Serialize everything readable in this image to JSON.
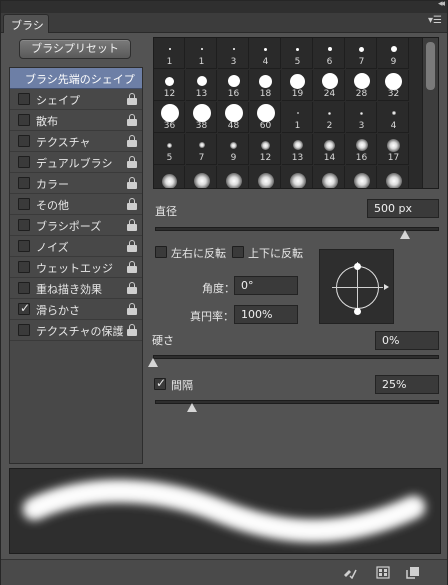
{
  "panel": {
    "tab_label": "ブラシ",
    "collapse_glyph": "◂◂",
    "menu_glyph": "▾☰"
  },
  "preset_button": {
    "label": "ブラシプリセット"
  },
  "left_list": {
    "selected": "ブラシ先端のシェイプ",
    "items": [
      {
        "label": "シェイプ",
        "checked": false
      },
      {
        "label": "散布",
        "checked": false
      },
      {
        "label": "テクスチャ",
        "checked": false
      },
      {
        "label": "デュアルブラシ",
        "checked": false
      },
      {
        "label": "カラー",
        "checked": false
      },
      {
        "label": "その他",
        "checked": false
      },
      {
        "label": "ブラシポーズ",
        "checked": false
      },
      {
        "label": "ノイズ",
        "checked": false
      },
      {
        "label": "ウェットエッジ",
        "checked": false
      },
      {
        "label": "重ね描き効果",
        "checked": false
      },
      {
        "label": "滑らかさ",
        "checked": true
      },
      {
        "label": "テクスチャの保護",
        "checked": false
      }
    ]
  },
  "brush_grid": {
    "tips": [
      {
        "num": "1",
        "size": 2,
        "soft": false
      },
      {
        "num": "1",
        "size": 2,
        "soft": false
      },
      {
        "num": "3",
        "size": 2,
        "soft": false
      },
      {
        "num": "4",
        "size": 3,
        "soft": false
      },
      {
        "num": "5",
        "size": 3,
        "soft": false
      },
      {
        "num": "6",
        "size": 4,
        "soft": false
      },
      {
        "num": "7",
        "size": 5,
        "soft": false
      },
      {
        "num": "9",
        "size": 6,
        "soft": false
      },
      {
        "num": "12",
        "size": 9,
        "soft": false
      },
      {
        "num": "13",
        "size": 10,
        "soft": false
      },
      {
        "num": "16",
        "size": 12,
        "soft": false
      },
      {
        "num": "18",
        "size": 13,
        "soft": false
      },
      {
        "num": "19",
        "size": 15,
        "soft": false
      },
      {
        "num": "24",
        "size": 16,
        "soft": false
      },
      {
        "num": "28",
        "size": 16,
        "soft": false
      },
      {
        "num": "32",
        "size": 17,
        "soft": false
      },
      {
        "num": "36",
        "size": 18,
        "soft": false
      },
      {
        "num": "38",
        "size": 18,
        "soft": false
      },
      {
        "num": "48",
        "size": 18,
        "soft": false
      },
      {
        "num": "60",
        "size": 18,
        "soft": false
      },
      {
        "num": "1",
        "size": 2,
        "soft": true
      },
      {
        "num": "2",
        "size": 3,
        "soft": true
      },
      {
        "num": "3",
        "size": 3,
        "soft": true
      },
      {
        "num": "4",
        "size": 4,
        "soft": true
      },
      {
        "num": "5",
        "size": 5,
        "soft": true
      },
      {
        "num": "7",
        "size": 6,
        "soft": true
      },
      {
        "num": "9",
        "size": 7,
        "soft": true
      },
      {
        "num": "12",
        "size": 9,
        "soft": true
      },
      {
        "num": "13",
        "size": 10,
        "soft": true
      },
      {
        "num": "14",
        "size": 11,
        "soft": true
      },
      {
        "num": "16",
        "size": 12,
        "soft": true
      },
      {
        "num": "17",
        "size": 13,
        "soft": true
      },
      {
        "num": "",
        "size": 15,
        "soft": true
      },
      {
        "num": "",
        "size": 16,
        "soft": true
      },
      {
        "num": "",
        "size": 16,
        "soft": true
      },
      {
        "num": "",
        "size": 16,
        "soft": true
      },
      {
        "num": "",
        "size": 16,
        "soft": true
      },
      {
        "num": "",
        "size": 16,
        "soft": true
      },
      {
        "num": "",
        "size": 16,
        "soft": true
      },
      {
        "num": "",
        "size": 16,
        "soft": true
      }
    ]
  },
  "diameter": {
    "label": "直径",
    "value": "500 px",
    "level": 0.88
  },
  "flip_x": {
    "label": "左右に反転",
    "checked": false
  },
  "flip_y": {
    "label": "上下に反転",
    "checked": false
  },
  "angle": {
    "label": "角度：",
    "value": "0°"
  },
  "roundness": {
    "label": "真円率：",
    "value": "100%"
  },
  "hardness": {
    "label": "硬さ",
    "value": "0%",
    "level": 0.0
  },
  "spacing": {
    "label": "間隔",
    "value": "25%",
    "checked": true,
    "level": 0.13
  },
  "colors": {
    "panel_bg": "#535353",
    "selection": "#6d7fa6",
    "field_bg": "#3a3a3a"
  },
  "bottom_icons": [
    "brush-pose-icon",
    "grid-view-icon",
    "new-preset-icon"
  ]
}
